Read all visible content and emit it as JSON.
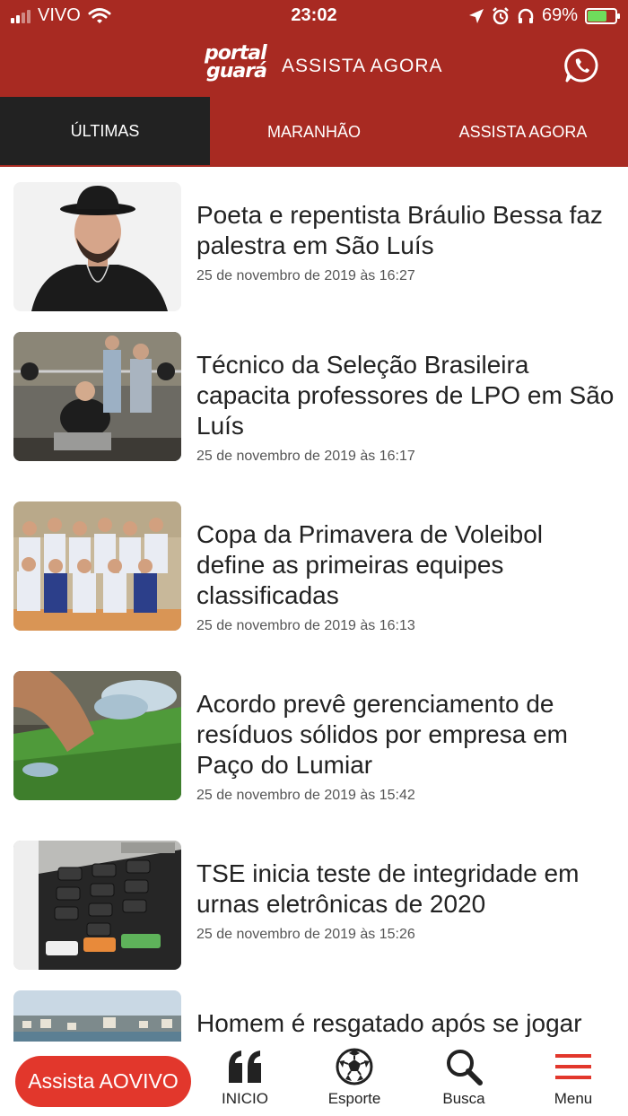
{
  "status_bar": {
    "carrier": "VIVO",
    "time": "23:02",
    "battery_percent": "69%",
    "battery_level": 0.69,
    "icons": [
      "signal-icon",
      "wifi-icon",
      "location-icon",
      "alarm-icon",
      "headphones-icon",
      "battery-icon"
    ]
  },
  "header": {
    "logo_line1": "portal",
    "logo_line2": "guará",
    "title": "ASSISTA AGORA",
    "whatsapp_icon": "whatsapp-icon"
  },
  "tabs": [
    {
      "label": "ÚLTIMAS",
      "active": true
    },
    {
      "label": "MARANHÃO",
      "active": false
    },
    {
      "label": "ASSISTA AGORA",
      "active": false
    }
  ],
  "news": [
    {
      "title": "Poeta e repentista Bráulio Bessa faz palestra em São Luís",
      "date": "25 de novembro de 2019 às 16:27"
    },
    {
      "title": "Técnico da Seleção Brasileira capacita professores de LPO em São Luís",
      "date": "25 de novembro de 2019 às 16:17"
    },
    {
      "title": "Copa da Primavera de Voleibol define as primeiras equipes classificadas",
      "date": "25 de novembro de 2019 às 16:13"
    },
    {
      "title": "Acordo prevê gerenciamento de resíduos sólidos por empresa em Paço do Lumiar",
      "date": "25 de novembro de 2019 às 15:42"
    },
    {
      "title": "TSE inicia teste de integridade em urnas eletrônicas de 2020",
      "date": "25 de novembro de 2019 às 15:26"
    },
    {
      "title": "Homem é resgatado após se jogar",
      "date": ""
    }
  ],
  "bottom_nav": {
    "live_button": "Assista AOVIVO",
    "items": [
      {
        "label": "INICIO",
        "icon": "quote-icon"
      },
      {
        "label": "Esporte",
        "icon": "soccer-ball-icon"
      },
      {
        "label": "Busca",
        "icon": "search-icon"
      },
      {
        "label": "Menu",
        "icon": "hamburger-menu-icon"
      }
    ]
  },
  "colors": {
    "brand_red": "#a82a22",
    "active_tab": "#222222",
    "live_button": "#e2372c"
  }
}
